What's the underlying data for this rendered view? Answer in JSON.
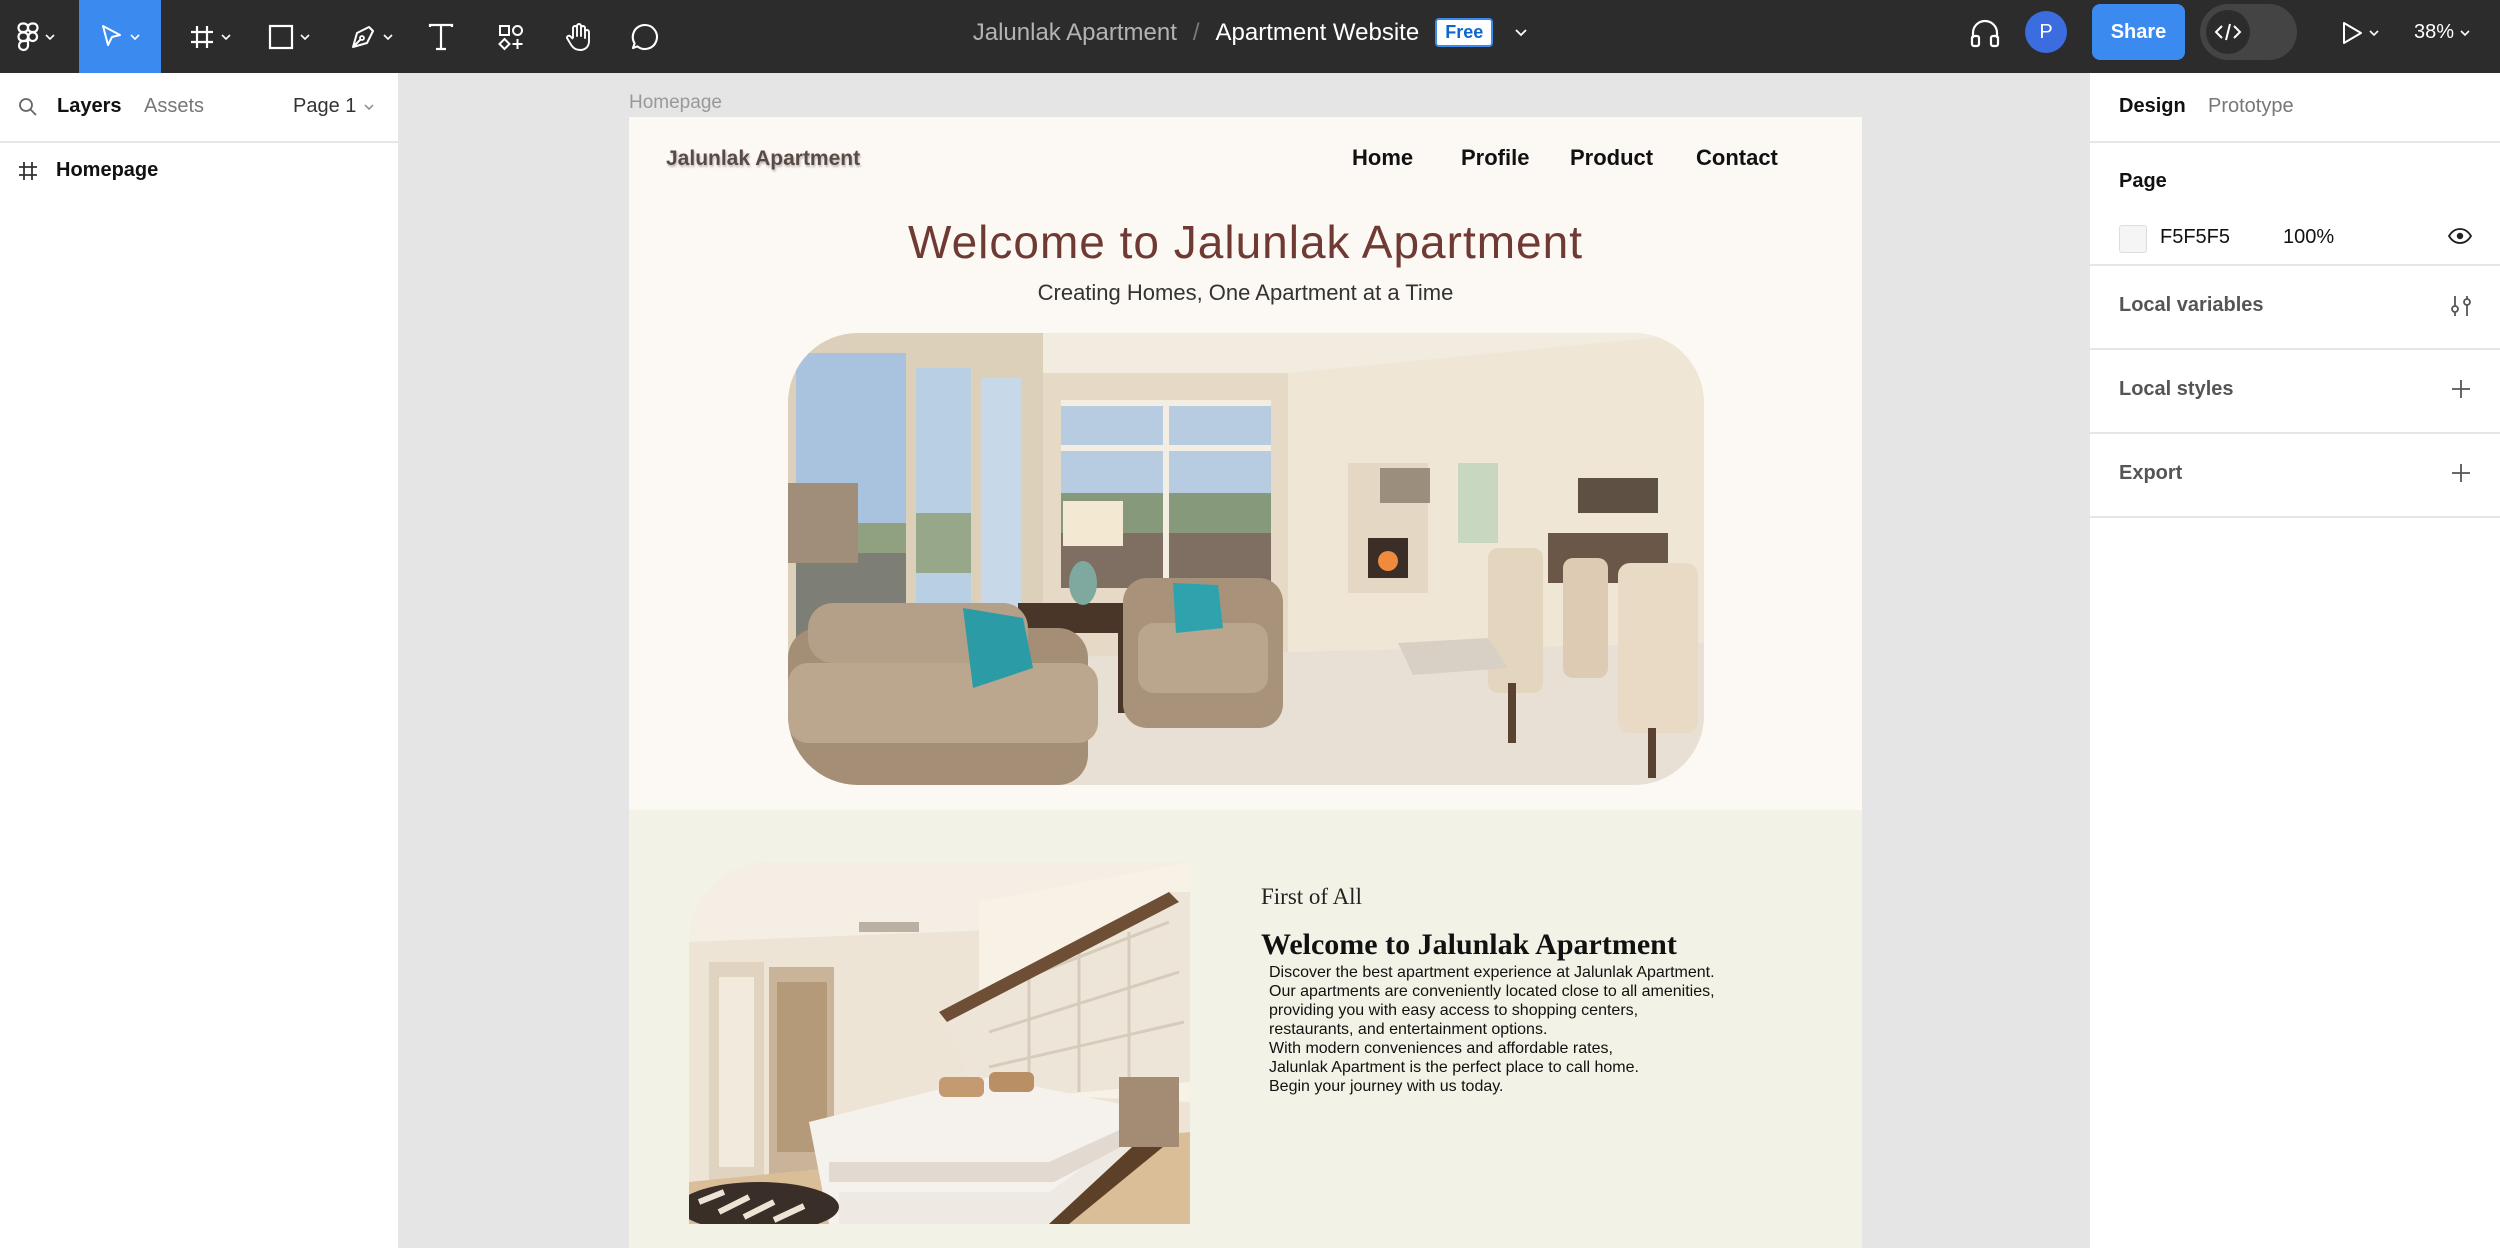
{
  "toolbar": {
    "file": {
      "project": "Jalunlak Apartment",
      "separator": "/",
      "name": "Apartment Website",
      "plan_badge": "Free"
    },
    "avatar_initial": "P",
    "share_label": "Share",
    "zoom": "38%",
    "tools": [
      "figma-menu",
      "move",
      "frame",
      "shape",
      "pen",
      "text",
      "resources",
      "hand",
      "comment"
    ],
    "accent": "#3B8AF0"
  },
  "left_panel": {
    "tabs": [
      "Layers",
      "Assets"
    ],
    "active_tab": "Layers",
    "page": "Page 1",
    "layers": [
      {
        "type": "frame",
        "name": "Homepage"
      }
    ]
  },
  "right_panel": {
    "tabs": [
      "Design",
      "Prototype"
    ],
    "active_tab": "Design",
    "page_section": {
      "title": "Page",
      "color_hex": "F5F5F5",
      "opacity": "100%"
    },
    "sections": [
      {
        "title": "Local variables",
        "icon": "variables-icon"
      },
      {
        "title": "Local styles",
        "icon": "plus-icon"
      },
      {
        "title": "Export",
        "icon": "plus-icon"
      }
    ]
  },
  "canvas": {
    "frame_label": "Homepage",
    "site": {
      "brand": "Jalunlak Apartment",
      "nav": [
        "Home",
        "Profile",
        "Product",
        "Contact"
      ],
      "hero_title": "Welcome to Jalunlak Apartment",
      "hero_subtitle": "Creating Homes, One Apartment at a Time",
      "section2": {
        "kicker": "First of All",
        "title": "Welcome to Jalunlak Apartment",
        "body": [
          "Discover the best apartment experience at Jalunlak Apartment.",
          "Our apartments are conveniently located close to all amenities,",
          "providing you with easy access to shopping centers,",
          "restaurants, and entertainment options.",
          "With modern conveniences and affordable rates,",
          "Jalunlak Apartment is the perfect place to call home.",
          "Begin your journey with us today."
        ]
      },
      "colors": {
        "hero_title": "#6E3A33",
        "hero_bg": "#FCF8F3",
        "section2_bg": "#F2F3E6"
      }
    }
  }
}
